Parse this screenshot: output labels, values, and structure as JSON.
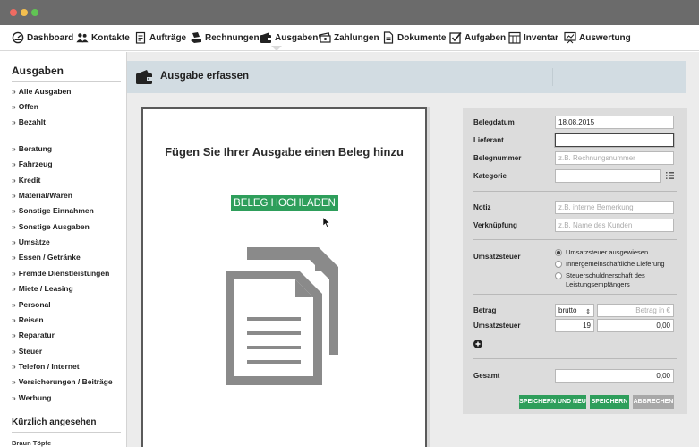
{
  "window": {
    "dots": [
      "close",
      "minimize",
      "maximize"
    ]
  },
  "nav": [
    {
      "id": "dashboard",
      "label": "Dashboard",
      "icon": "speedometer-icon"
    },
    {
      "id": "kontakte",
      "label": "Kontakte",
      "icon": "people-icon"
    },
    {
      "id": "auftraege",
      "label": "Aufträge",
      "icon": "clipboard-icon"
    },
    {
      "id": "rechnungen",
      "label": "Rechnungen",
      "icon": "invoice-hand-icon"
    },
    {
      "id": "ausgaben",
      "label": "Ausgaben",
      "icon": "wallet-icon"
    },
    {
      "id": "zahlungen",
      "label": "Zahlungen",
      "icon": "money-icon"
    },
    {
      "id": "dokumente",
      "label": "Dokumente",
      "icon": "document-icon"
    },
    {
      "id": "aufgaben",
      "label": "Aufgaben",
      "icon": "checkbox-icon"
    },
    {
      "id": "inventar",
      "label": "Inventar",
      "icon": "inventory-icon"
    },
    {
      "id": "auswertung",
      "label": "Auswertung",
      "icon": "chart-board-icon"
    }
  ],
  "sidebar": {
    "title": "Ausgaben",
    "group1": [
      "Alle Ausgaben",
      "Offen",
      "Bezahlt"
    ],
    "group2": [
      "Beratung",
      "Fahrzeug",
      "Kredit",
      "Material/Waren",
      "Sonstige Einnahmen",
      "Sonstige Ausgaben",
      "Umsätze",
      "Essen / Getränke",
      "Fremde Dienstleistungen",
      "Miete / Leasing",
      "Personal",
      "Reisen",
      "Reparatur",
      "Steuer",
      "Telefon / Internet",
      "Versicherungen / Beiträge",
      "Werbung"
    ],
    "recent_title": "Kürzlich angesehen",
    "recent_items": [
      "Braun Töpfe"
    ]
  },
  "header": {
    "title": "Ausgabe erfassen"
  },
  "upload": {
    "title": "Fügen Sie Ihrer Ausgabe einen Beleg hinzu",
    "button": "BELEG HOCHLADEN"
  },
  "form": {
    "belegdatum": {
      "label": "Belegdatum",
      "value": "18.08.2015"
    },
    "lieferant": {
      "label": "Lieferant",
      "value": ""
    },
    "belegnummer": {
      "label": "Belegnummer",
      "placeholder": "z.B. Rechnungsnummer"
    },
    "kategorie": {
      "label": "Kategorie",
      "value": ""
    },
    "notiz": {
      "label": "Notiz",
      "placeholder": "z.B. interne Bemerkung"
    },
    "verknuepfung": {
      "label": "Verknüpfung",
      "placeholder": "z.B. Name des Kunden"
    },
    "umsatzsteuer_options": {
      "label": "Umsatzsteuer",
      "options": [
        "Umsatzsteuer ausgewiesen",
        "Innergemeinschaftliche Lieferung",
        "Steuerschuldnerschaft des Leistungsempfängers"
      ],
      "selected": 0
    },
    "betrag": {
      "label": "Betrag",
      "mode": "brutto",
      "placeholder": "Betrag in €"
    },
    "umsatzsteuer_rate": {
      "label": "Umsatzsteuer",
      "rate": "19",
      "value": "0,00"
    },
    "gesamt": {
      "label": "Gesamt",
      "value": "0,00"
    },
    "buttons": {
      "save_new": "SPEICHERN UND NEU",
      "save": "SPEICHERN",
      "cancel": "ABBRECHEN"
    }
  },
  "colors": {
    "accent": "#2e9e5b",
    "header_band": "#d2dce2",
    "form_bg": "#dcdcdc",
    "titlebar": "#6b6b6b"
  }
}
